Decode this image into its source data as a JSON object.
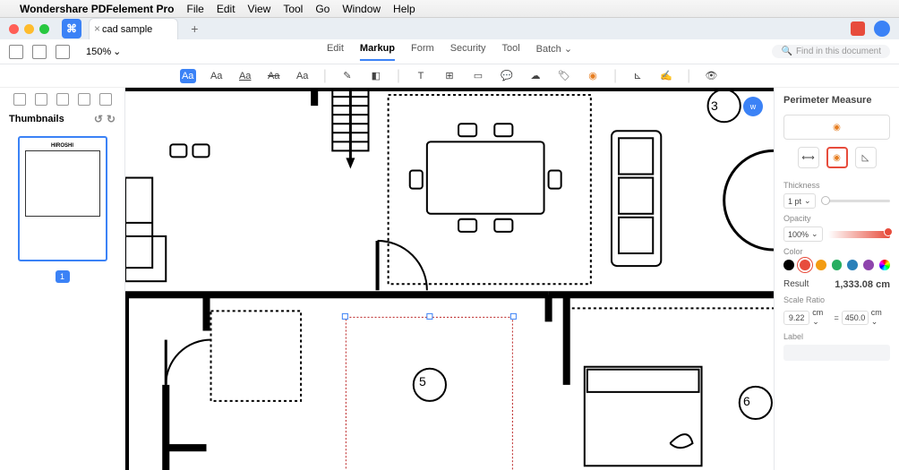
{
  "menubar": {
    "app": "Wondershare PDFelement Pro",
    "items": [
      "File",
      "Edit",
      "View",
      "Tool",
      "Go",
      "Window",
      "Help"
    ]
  },
  "tab": {
    "title": "cad sample"
  },
  "toolbar": {
    "zoom": "150%",
    "tabs": [
      "Edit",
      "Markup",
      "Form",
      "Security",
      "Tool"
    ],
    "batch": "Batch",
    "active_tab": "Markup",
    "search_placeholder": "Find in this document"
  },
  "markup_tools": [
    "Aa",
    "Aa",
    "Aa",
    "Aa",
    "Aa"
  ],
  "sidebar": {
    "title": "Thumbnails",
    "thumb_title": "HIROSHI",
    "page": "1"
  },
  "floorplan": {
    "nodes": {
      "three": "3",
      "five": "5",
      "six": "6"
    }
  },
  "right": {
    "title": "Perimeter Measure",
    "thickness_label": "Thickness",
    "thickness_value": "1 pt",
    "opacity_label": "Opacity",
    "opacity_value": "100%",
    "color_label": "Color",
    "colors": [
      "#000000",
      "#e74c3c",
      "#f39c12",
      "#27ae60",
      "#2980b9",
      "#8e44ad"
    ],
    "selected_color": 1,
    "result_label": "Result",
    "result_value": "1,333.08 cm",
    "scale_label": "Scale Ratio",
    "scale_from": "9.22",
    "scale_to": "450.0",
    "scale_unit": "cm",
    "equals": "=",
    "label_label": "Label"
  }
}
